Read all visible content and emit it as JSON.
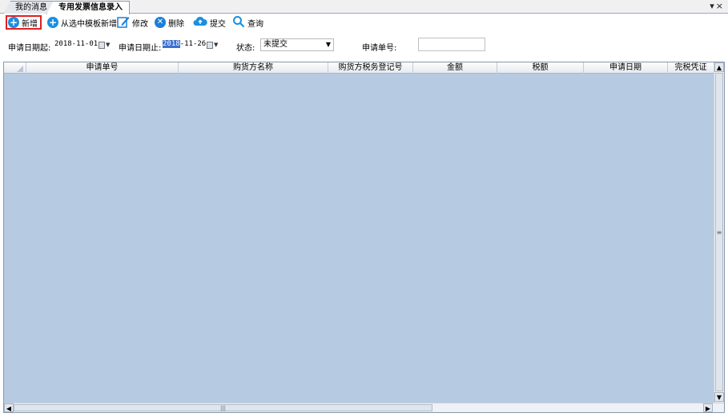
{
  "tabs": [
    {
      "label": "我的消息",
      "active": false
    },
    {
      "label": "专用发票信息录入",
      "active": true
    }
  ],
  "tab_controls": {
    "dropdown": "▾",
    "close": "×"
  },
  "toolbar": {
    "new_label": "新增",
    "new_from_template_label": "从选中模板新增",
    "edit_label": "修改",
    "delete_label": "删除",
    "submit_label": "提交",
    "query_label": "查询"
  },
  "filters": {
    "date_from_label": "申请日期起:",
    "date_from_value": "2018-11-01",
    "date_to_label": "申请日期止:",
    "date_to_value_selected": "2018",
    "date_to_value_rest": "-11-26",
    "status_label": "状态:",
    "status_value": "未提交",
    "application_no_label": "申请单号:",
    "application_no_value": ""
  },
  "table": {
    "columns": [
      "申请单号",
      "购货方名称",
      "购货方税务登记号",
      "金额",
      "税额",
      "申请日期",
      "完税凭证"
    ],
    "rows": []
  },
  "colors": {
    "grid_background": "#b6cbe2",
    "highlight_border": "#e02020",
    "accent_blue": "#1a8fe0"
  }
}
